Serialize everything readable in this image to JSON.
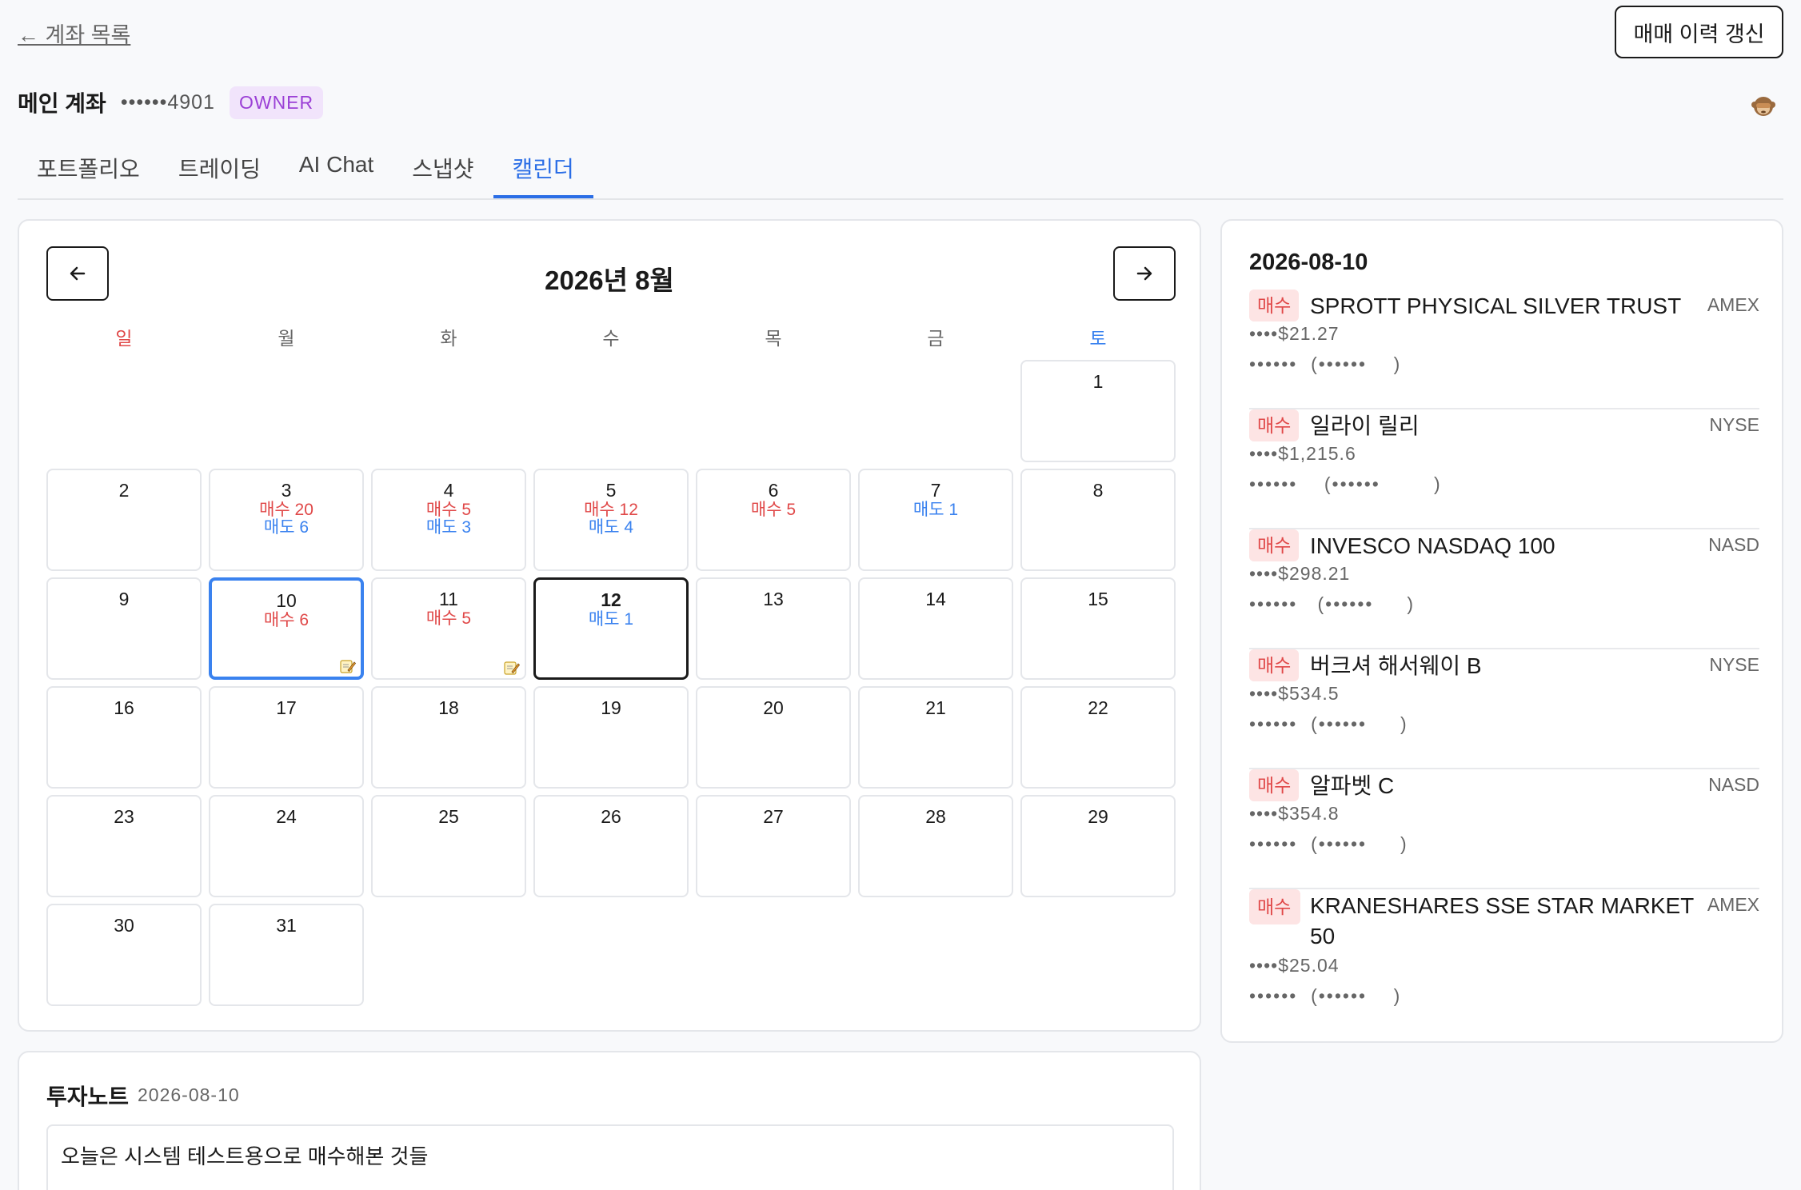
{
  "nav": {
    "back_label": "← 계좌 목록",
    "refresh_label": "매매 이력 갱신"
  },
  "account": {
    "name": "메인 계좌",
    "masked_number": "••••••4901",
    "role_badge": "OWNER",
    "privacy_icon": "see-no-evil-monkey-icon"
  },
  "tabs": [
    {
      "label": "포트폴리오",
      "active": false
    },
    {
      "label": "트레이딩",
      "active": false
    },
    {
      "label": "AI Chat",
      "active": false
    },
    {
      "label": "스냅샷",
      "active": false
    },
    {
      "label": "캘린더",
      "active": true
    }
  ],
  "calendar": {
    "title": "2026년 8월",
    "prev_icon": "arrow-left-icon",
    "next_icon": "arrow-right-icon",
    "weekdays": [
      "일",
      "월",
      "화",
      "수",
      "목",
      "금",
      "토"
    ],
    "colors": {
      "sunday": "#e04848",
      "saturday": "#3a82ef",
      "buy": "#e04848",
      "sell": "#3a82ef",
      "selected": "#3a82ef"
    },
    "days": [
      {
        "day": "1",
        "buy": "",
        "sell": ""
      },
      {
        "day": "2",
        "buy": "",
        "sell": ""
      },
      {
        "day": "3",
        "buy": "매수 20",
        "sell": "매도 6"
      },
      {
        "day": "4",
        "buy": "매수 5",
        "sell": "매도 3"
      },
      {
        "day": "5",
        "buy": "매수 12",
        "sell": "매도 4"
      },
      {
        "day": "6",
        "buy": "매수 5",
        "sell": ""
      },
      {
        "day": "7",
        "buy": "",
        "sell": "매도 1"
      },
      {
        "day": "8",
        "buy": "",
        "sell": ""
      },
      {
        "day": "9",
        "buy": "",
        "sell": ""
      },
      {
        "day": "10",
        "buy": "매수 6",
        "sell": "",
        "memo": true,
        "selected": true
      },
      {
        "day": "11",
        "buy": "매수 5",
        "sell": "",
        "memo": true
      },
      {
        "day": "12",
        "buy": "",
        "sell": "매도 1",
        "today": true
      },
      {
        "day": "13",
        "buy": "",
        "sell": ""
      },
      {
        "day": "14",
        "buy": "",
        "sell": ""
      },
      {
        "day": "15",
        "buy": "",
        "sell": ""
      },
      {
        "day": "16",
        "buy": "",
        "sell": ""
      },
      {
        "day": "17",
        "buy": "",
        "sell": ""
      },
      {
        "day": "18",
        "buy": "",
        "sell": ""
      },
      {
        "day": "19",
        "buy": "",
        "sell": ""
      },
      {
        "day": "20",
        "buy": "",
        "sell": ""
      },
      {
        "day": "21",
        "buy": "",
        "sell": ""
      },
      {
        "day": "22",
        "buy": "",
        "sell": ""
      },
      {
        "day": "23",
        "buy": "",
        "sell": ""
      },
      {
        "day": "24",
        "buy": "",
        "sell": ""
      },
      {
        "day": "25",
        "buy": "",
        "sell": ""
      },
      {
        "day": "26",
        "buy": "",
        "sell": ""
      },
      {
        "day": "27",
        "buy": "",
        "sell": ""
      },
      {
        "day": "28",
        "buy": "",
        "sell": ""
      },
      {
        "day": "29",
        "buy": "",
        "sell": ""
      },
      {
        "day": "30",
        "buy": "",
        "sell": ""
      },
      {
        "day": "31",
        "buy": "",
        "sell": ""
      }
    ],
    "memo_icon": "memo-pencil-icon"
  },
  "detail": {
    "date": "2026-08-10",
    "trades": [
      {
        "side": "매수",
        "name": "SPROTT PHYSICAL SILVER TRUST",
        "exchange": "AMEX",
        "price": "••••$21.27",
        "qty": "••••••  (••••••    )"
      },
      {
        "side": "매수",
        "name": "일라이 릴리",
        "exchange": "NYSE",
        "price": "••••$1,215.6",
        "qty": "••••••    (••••••        )"
      },
      {
        "side": "매수",
        "name": "INVESCO NASDAQ 100",
        "exchange": "NASD",
        "price": "••••$298.21",
        "qty": "••••••   (••••••     )"
      },
      {
        "side": "매수",
        "name": "버크셔 해서웨이 B",
        "exchange": "NYSE",
        "price": "••••$534.5",
        "qty": "••••••  (••••••     )"
      },
      {
        "side": "매수",
        "name": "알파벳 C",
        "exchange": "NASD",
        "price": "••••$354.8",
        "qty": "••••••  (••••••     )"
      },
      {
        "side": "매수",
        "name": "KRANESHARES SSE STAR MARKET 50",
        "exchange": "AMEX",
        "price": "••••$25.04",
        "qty": "••••••  (••••••    )"
      }
    ]
  },
  "note": {
    "title": "투자노트",
    "date": "2026-08-10",
    "content": "오늘은 시스템 테스트용으로 매수해본 것들"
  }
}
